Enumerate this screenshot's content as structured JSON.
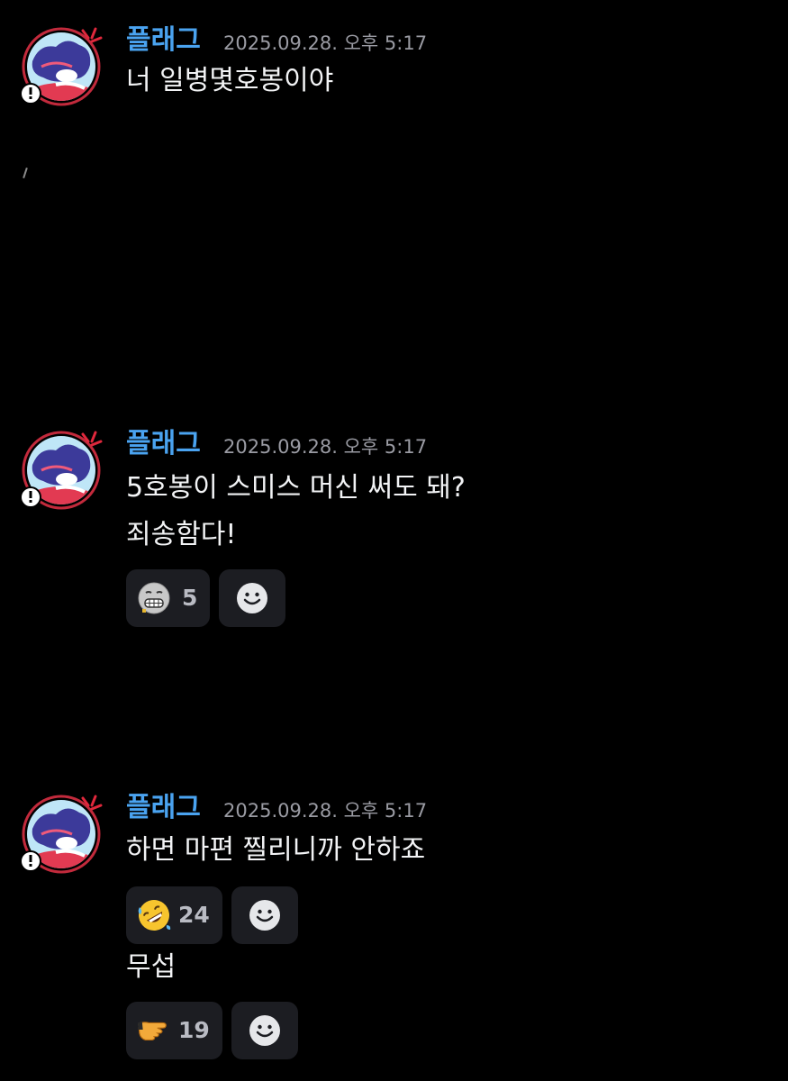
{
  "colors": {
    "background": "#000000",
    "username": "#4aa3f0",
    "timestamp": "#9a9ba3",
    "text": "#f2f3f5",
    "reaction_bg": "#1c1d22"
  },
  "messages": [
    {
      "author": "플래그",
      "timestamp": "2025.09.28. 오후 5:17",
      "lines": [
        "너 일병몇호봉이야"
      ],
      "reactions": []
    },
    {
      "author": "플래그",
      "timestamp": "2025.09.28. 오후 5:17",
      "lines": [
        "5호봉이 스미스 머신 써도 돼?",
        "죄송함다!"
      ],
      "reactions": [
        {
          "emoji": "grimacing-face-emoji",
          "count": "5"
        }
      ]
    },
    {
      "author": "플래그",
      "timestamp": "2025.09.28. 오후 5:17",
      "lines": [
        "하면 마편 찔리니까 안하죠"
      ],
      "reactions": [
        {
          "emoji": "rolling-on-floor-laughing-emoji",
          "count": "24"
        }
      ],
      "followup": {
        "text": "무섭",
        "reactions": [
          {
            "emoji": "pointing-hand-emoji",
            "count": "19"
          }
        ]
      }
    }
  ],
  "icons": {
    "add_reaction": "smiley-add-reaction-icon",
    "avatar_badge": "exclamation-badge-icon",
    "avatar_anger": "anger-symbol-icon"
  }
}
